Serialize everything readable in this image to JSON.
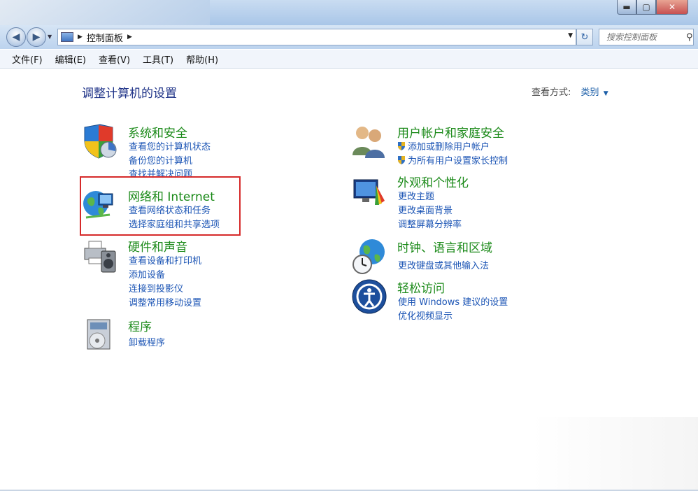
{
  "window": {
    "min": "▬",
    "max": "▢",
    "close": "✕"
  },
  "nav": {
    "back": "◀",
    "forward": "▶",
    "breadcrumb": "控制面板"
  },
  "search": {
    "placeholder": "搜索控制面板"
  },
  "menu": [
    "文件(F)",
    "编辑(E)",
    "查看(V)",
    "工具(T)",
    "帮助(H)"
  ],
  "main": {
    "title": "调整计算机的设置",
    "view_label": "查看方式:",
    "view_value": "类别"
  },
  "categories_left": [
    {
      "title": "系统和安全",
      "links": [
        "查看您的计算机状态",
        "备份您的计算机",
        "查找并解决问题"
      ]
    },
    {
      "title": "网络和 Internet",
      "links": [
        "查看网络状态和任务",
        "选择家庭组和共享选项"
      ]
    },
    {
      "title": "硬件和声音",
      "links": [
        "查看设备和打印机",
        "添加设备",
        "连接到投影仪",
        "调整常用移动设置"
      ]
    },
    {
      "title": "程序",
      "links": [
        "卸载程序"
      ]
    }
  ],
  "categories_right": [
    {
      "title": "用户帐户和家庭安全",
      "links": [
        "添加或删除用户帐户",
        "为所有用户设置家长控制"
      ]
    },
    {
      "title": "外观和个性化",
      "links": [
        "更改主题",
        "更改桌面背景",
        "调整屏幕分辨率"
      ]
    },
    {
      "title": "时钟、语言和区域",
      "links": [
        "更改键盘或其他输入法"
      ]
    },
    {
      "title": "轻松访问",
      "links": [
        "使用 Windows 建议的设置",
        "优化视频显示"
      ]
    }
  ],
  "colors": {
    "category_title": "#1b8a19",
    "link": "#1c55b5",
    "page_title": "#1e3287",
    "highlight": "#d62a2a"
  }
}
